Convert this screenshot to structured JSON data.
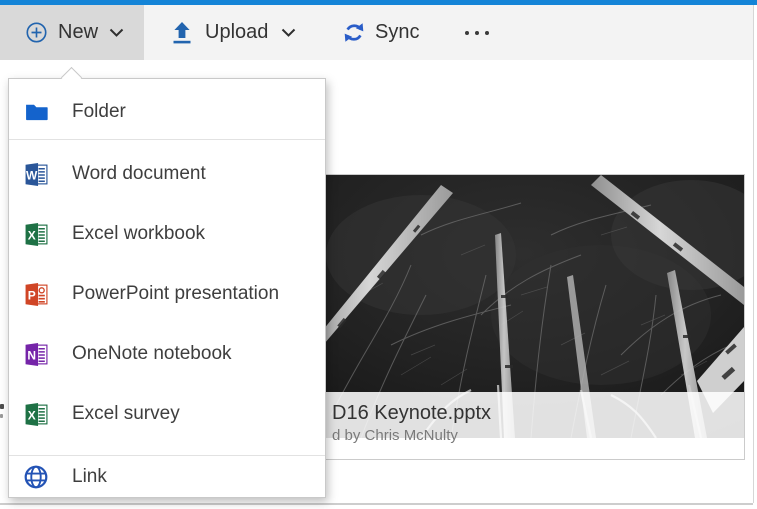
{
  "toolbar": {
    "new": {
      "label": "New",
      "icon": "plus-circle-icon"
    },
    "upload": {
      "label": "Upload",
      "icon": "upload-arrow-icon"
    },
    "sync": {
      "label": "Sync",
      "icon": "sync-icon"
    },
    "more": {
      "icon": "ellipsis-icon"
    }
  },
  "menu": {
    "items": [
      {
        "label": "Folder",
        "icon": "folder-icon"
      },
      {
        "label": "Word document",
        "icon": "word-icon",
        "letter": "W"
      },
      {
        "label": "Excel workbook",
        "icon": "excel-icon",
        "letter": "X"
      },
      {
        "label": "PowerPoint presentation",
        "icon": "powerpoint-icon",
        "letter": "P"
      },
      {
        "label": "OneNote notebook",
        "icon": "onenote-icon",
        "letter": "N"
      },
      {
        "label": "Excel survey",
        "icon": "excel-survey-icon",
        "letter": "X"
      },
      {
        "label": "Link",
        "icon": "globe-icon"
      }
    ]
  },
  "file_tile": {
    "title": "D16 Keynote.pptx",
    "subtitle": "d by Chris McNulty"
  },
  "colors": {
    "suite_bar": "#1484d7",
    "new_button_bg": "#d9d9d9",
    "toolbar_bg": "#f3f3f3",
    "toolbar_icon_blue": "#2264ae",
    "sync_icon_blue": "#2a5dc8",
    "folder_blue": "#1463cc",
    "word_blue": "#2a5699",
    "excel_green": "#1e7145",
    "powerpoint_red": "#d04526",
    "onenote_purple": "#7524a8",
    "link_globe_blue": "#2353b5"
  }
}
